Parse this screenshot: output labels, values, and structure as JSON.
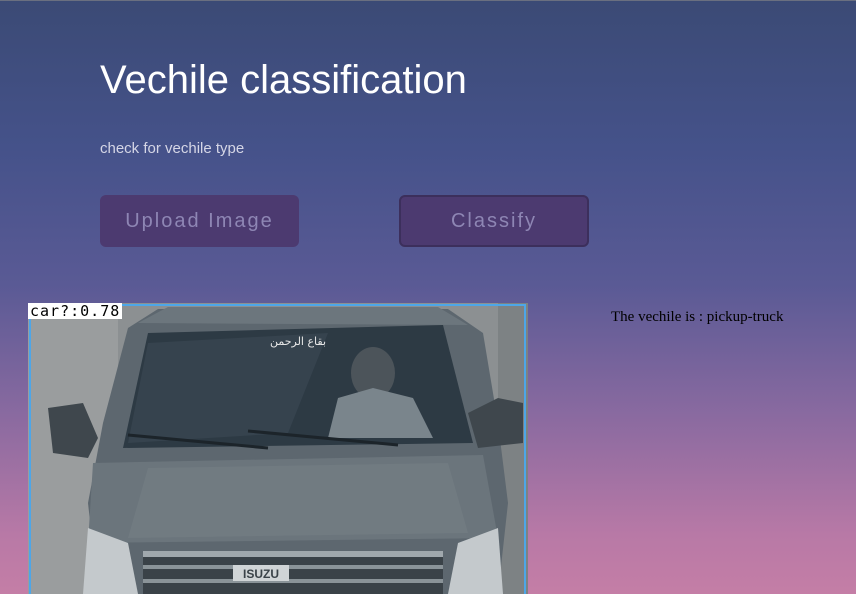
{
  "header": {
    "title": "Vechile classification",
    "subtitle": "check for vechile type"
  },
  "actions": {
    "upload_label": "Upload Image",
    "classify_label": "Classify"
  },
  "result": {
    "text": "The vechile is : pickup-truck"
  },
  "detection": {
    "label": "car?:0.78",
    "grille_badge": "ISUZU",
    "windshield_sticker": "بقاع الرحمن"
  },
  "colors": {
    "button_bg": "#4c3a70",
    "button_text": "#8e86b4",
    "bbox": "#4da6e8"
  }
}
